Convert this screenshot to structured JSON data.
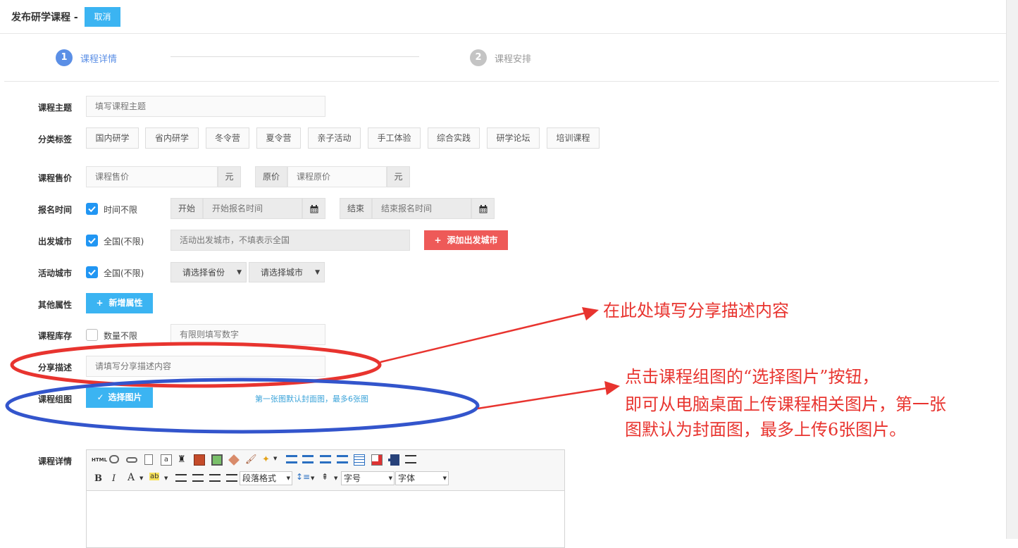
{
  "header": {
    "title": "发布研学课程",
    "separator": "-",
    "cancel_label": "取消"
  },
  "steps": [
    {
      "number": "1",
      "label": "课程详情",
      "active": true,
      "color": "#5b8fe6"
    },
    {
      "number": "2",
      "label": "课程安排",
      "active": false,
      "color": "#c4c4c4"
    }
  ],
  "form": {
    "topic": {
      "label": "课程主题",
      "placeholder": "填写课程主题"
    },
    "tags": {
      "label": "分类标签",
      "items": [
        "国内研学",
        "省内研学",
        "冬令营",
        "夏令营",
        "亲子活动",
        "手工体验",
        "综合实践",
        "研学论坛",
        "培训课程"
      ]
    },
    "price": {
      "label": "课程售价",
      "sale_placeholder": "课程售价",
      "unit": "元",
      "orig_prefix": "原价",
      "orig_placeholder": "课程原价",
      "orig_unit": "元"
    },
    "signup_time": {
      "label": "报名时间",
      "check_label": "时间不限",
      "checked": true,
      "start_prefix": "开始",
      "start_placeholder": "开始报名时间",
      "end_prefix": "结束",
      "end_placeholder": "结束报名时间",
      "calendar_icon": "calendar-icon"
    },
    "depart_city": {
      "label": "出发城市",
      "check_label": "全国(不限)",
      "checked": true,
      "placeholder": "活动出发城市，不填表示全国",
      "add_button": "添加出发城市"
    },
    "activity_city": {
      "label": "活动城市",
      "check_label": "全国(不限)",
      "checked": true,
      "province": "请选择省份",
      "city": "请选择城市"
    },
    "other_attrs": {
      "label": "其他属性",
      "add_button": "新增属性"
    },
    "stock": {
      "label": "课程库存",
      "check_label": "数量不限",
      "checked": false,
      "placeholder": "有限则填写数字"
    },
    "share_desc": {
      "label": "分享描述",
      "placeholder": "请填写分享描述内容"
    },
    "gallery": {
      "label": "课程组图",
      "button": "选择图片",
      "hint": "第一张图默认封面图，最多6张图"
    },
    "detail": {
      "label": "课程详情",
      "paragraph_format": "段落格式",
      "font_size": "字号",
      "font_family": "字体",
      "html_label": "HTML"
    }
  },
  "annotations": {
    "share_note": "在此处填写分享描述内容",
    "gallery_note": [
      "点击课程组图的“选择图片”按钮，",
      "即可从电脑桌面上传课程相关图片，第一张",
      "图默认为封面图，最多上传6张图片。"
    ]
  },
  "colors": {
    "accent_blue": "#3bb4f2",
    "accent_red": "#ee5a58",
    "checkbox_blue": "#2196f3",
    "annotation_red": "#e8342f",
    "annotation_blue": "#3355cc"
  }
}
